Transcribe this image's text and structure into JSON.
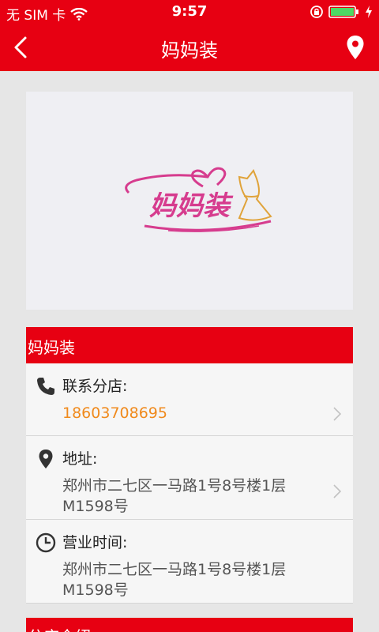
{
  "status_bar": {
    "carrier": "无 SIM 卡",
    "time": "9:57"
  },
  "nav": {
    "title": "妈妈装"
  },
  "banner": {
    "logo_text": "妈妈装"
  },
  "store_card": {
    "title": "妈妈装",
    "contact": {
      "label": "联系分店:",
      "value": "18603708695"
    },
    "address": {
      "label": "地址:",
      "value": "郑州市二七区一马路1号8号楼1层M1598号"
    },
    "hours": {
      "label": "营业时间:",
      "value": "郑州市二七区一马路1号8号楼1层M1598号"
    }
  },
  "next_section": {
    "title": "分店介绍"
  },
  "colors": {
    "brand_red": "#e70012",
    "phone_orange": "#f08a1c",
    "logo_pink": "#d63c8e"
  }
}
